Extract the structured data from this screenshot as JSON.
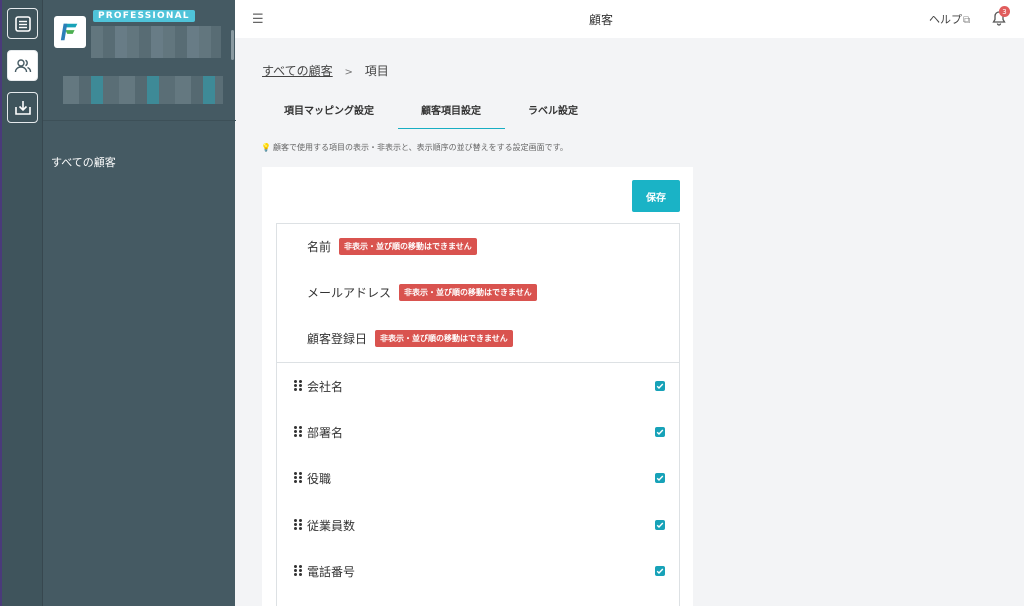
{
  "sidebar": {
    "plan_badge": "PROFESSIONAL",
    "nav_item": "すべての顧客"
  },
  "header": {
    "title": "顧客",
    "help_label": "ヘルプ",
    "notification_count": "3"
  },
  "breadcrumb": {
    "root": "すべての顧客",
    "separator": ">",
    "current": "項目"
  },
  "tabs": [
    {
      "label": "項目マッピング設定"
    },
    {
      "label": "顧客項目設定",
      "active": true
    },
    {
      "label": "ラベル設定"
    }
  ],
  "hint": "顧客で使用する項目の表示・非表示と、表示順序の並び替えをする設定画面です。",
  "save_label": "保存",
  "fixed_fields": [
    {
      "name": "名前",
      "badge": "非表示・並び順の移動はできません"
    },
    {
      "name": "メールアドレス",
      "badge": "非表示・並び順の移動はできません"
    },
    {
      "name": "顧客登録日",
      "badge": "非表示・並び順の移動はできません"
    }
  ],
  "fields": [
    {
      "name": "会社名",
      "checked": true
    },
    {
      "name": "部署名",
      "checked": true
    },
    {
      "name": "役職",
      "checked": true
    },
    {
      "name": "従業員数",
      "checked": true
    },
    {
      "name": "電話番号",
      "checked": true
    }
  ],
  "colors": {
    "accent": "#1ab3c6",
    "sidebar": "#455a63",
    "rail": "#3f545c",
    "warning": "#d9534f",
    "badge": "#4fc3d9"
  }
}
